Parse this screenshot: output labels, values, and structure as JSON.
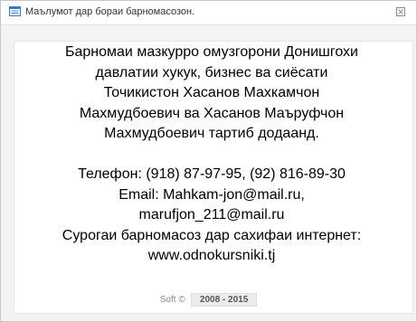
{
  "window": {
    "title": "Маълумот дар бораи барномасозон.",
    "close_glyph": "⊠",
    "colors": {
      "background": "#f3f3f3",
      "panel": "#ffffff",
      "icon_blue": "#3a78c8"
    }
  },
  "content": {
    "lines": [
      "Барномаи мазкурро омузгорони Донишгохи",
      "давлатии хукук, бизнес ва сиёсати",
      "Точикистон Хасанов Махкамчон",
      "Махмудбоевич ва Хасанов Маъруфчон",
      "Махмудбоевич тартиб додаанд.",
      "",
      "Телефон: (918) 87-97-95, (92) 816-89-30",
      "Email: Mahkam-jon@mail.ru,",
      "marufjon_211@mail.ru",
      "Сурогаи барномасоз дар сахифаи интернет:",
      "www.odnokursniki.tj"
    ]
  },
  "footer": {
    "soft_label": "Soft",
    "copyright_symbol": "©",
    "years": "2008 - 2015"
  }
}
